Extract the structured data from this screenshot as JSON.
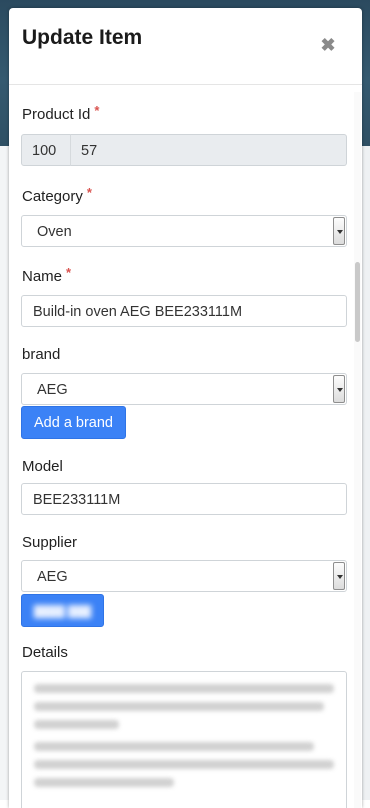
{
  "modal": {
    "title": "Update Item",
    "close_icon": "close-icon"
  },
  "form": {
    "product_id": {
      "label": "Product Id",
      "required": "*",
      "prefix": "100",
      "value": "57"
    },
    "category": {
      "label": "Category",
      "required": "*",
      "selected": "Oven"
    },
    "name": {
      "label": "Name",
      "required": "*",
      "value": "Build-in oven AEG BEE233111M"
    },
    "brand": {
      "label": "brand",
      "selected": "AEG",
      "add_button_label": "Add a brand"
    },
    "model": {
      "label": "Model",
      "value": "BEE233111M"
    },
    "supplier": {
      "label": "Supplier",
      "selected": "AEG"
    },
    "details": {
      "label": "Details"
    }
  },
  "colors": {
    "primary_button": "#3b82f6",
    "required_asterisk": "#d9534f",
    "readonly_bg": "#e9ecef"
  }
}
